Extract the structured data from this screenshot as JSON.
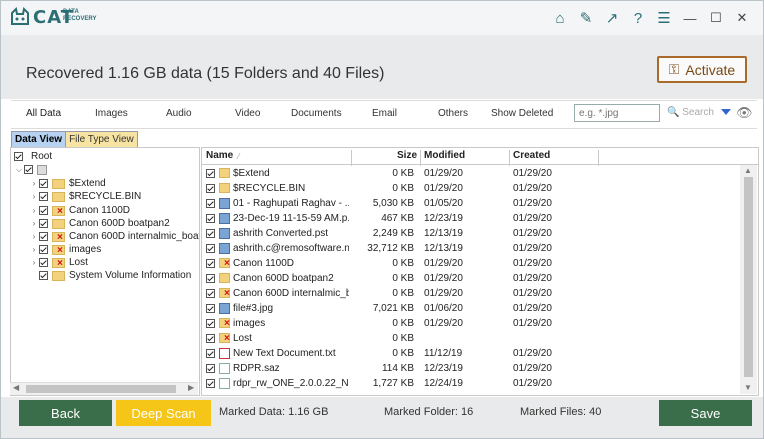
{
  "app": {
    "logo_name": "CAT",
    "logo_sub1": "DATA",
    "logo_sub2": "RECOVERY"
  },
  "titlebar_icons": [
    "home-icon",
    "wrench-icon",
    "export-icon",
    "help-icon",
    "menu-icon",
    "minimize-icon",
    "maximize-icon",
    "close-icon"
  ],
  "header": {
    "headline": "Recovered 1.16 GB data (15 Folders and 40 Files)",
    "activate_label": "Activate"
  },
  "tabs": [
    "All Data",
    "Images",
    "Audio",
    "Video",
    "Documents",
    "Email",
    "Others",
    "Show Deleted"
  ],
  "search": {
    "placeholder": "e.g. *.jpg",
    "button_label": "Search"
  },
  "view_tabs": {
    "data_view": "Data View",
    "file_type_view": "File Type View"
  },
  "tree": {
    "root": "Root",
    "items": [
      "$Extend",
      "$RECYCLE.BIN",
      "Canon 1100D",
      "Canon 600D boatpan2",
      "Canon 600D internalmic_boat-",
      "images",
      "Lost",
      "System Volume Information"
    ]
  },
  "file_table": {
    "headers": {
      "name": "Name",
      "size": "Size",
      "modified": "Modified",
      "created": "Created"
    },
    "rows": [
      {
        "name": "$Extend",
        "size": "0 KB",
        "modified": "01/29/20",
        "created": "01/29/20",
        "icon": "folder"
      },
      {
        "name": "$RECYCLE.BIN",
        "size": "0 KB",
        "modified": "01/29/20",
        "created": "01/29/20",
        "icon": "folder"
      },
      {
        "name": "01 - Raghupati Raghav - ...",
        "size": "5,030 KB",
        "modified": "01/05/20",
        "created": "01/29/20",
        "icon": "audio-file"
      },
      {
        "name": "23-Dec-19 11-15-59 AM.p...",
        "size": "467 KB",
        "modified": "12/23/19",
        "created": "01/29/20",
        "icon": "image-file"
      },
      {
        "name": "ashrith Converted.pst",
        "size": "2,249 KB",
        "modified": "12/13/19",
        "created": "01/29/20",
        "icon": "outlook-file"
      },
      {
        "name": "ashrith.c@remosoftware.n...",
        "size": "32,712 KB",
        "modified": "12/13/19",
        "created": "01/29/20",
        "icon": "outlook-file"
      },
      {
        "name": "Canon 1100D",
        "size": "0 KB",
        "modified": "01/29/20",
        "created": "01/29/20",
        "icon": "folder-deleted"
      },
      {
        "name": "Canon 600D boatpan2",
        "size": "0 KB",
        "modified": "01/29/20",
        "created": "01/29/20",
        "icon": "folder"
      },
      {
        "name": "Canon 600D internalmic_b...",
        "size": "0 KB",
        "modified": "01/29/20",
        "created": "01/29/20",
        "icon": "folder-deleted"
      },
      {
        "name": "file#3.jpg",
        "size": "7,021 KB",
        "modified": "01/06/20",
        "created": "01/29/20",
        "icon": "image-file"
      },
      {
        "name": "images",
        "size": "0 KB",
        "modified": "01/29/20",
        "created": "01/29/20",
        "icon": "folder-deleted"
      },
      {
        "name": "Lost",
        "size": "0 KB",
        "modified": "",
        "created": "",
        "icon": "folder-deleted"
      },
      {
        "name": "New Text Document.txt",
        "size": "0 KB",
        "modified": "11/12/19",
        "created": "01/29/20",
        "icon": "text-file-deleted"
      },
      {
        "name": "RDPR.saz",
        "size": "114 KB",
        "modified": "12/23/19",
        "created": "01/29/20",
        "icon": "file"
      },
      {
        "name": "rdpr_rw_ONE_2.0.0.22_Nol...",
        "size": "1,727 KB",
        "modified": "12/24/19",
        "created": "01/29/20",
        "icon": "file"
      }
    ]
  },
  "footer": {
    "back_label": "Back",
    "deep_scan_label": "Deep Scan",
    "marked_data": "Marked Data:  1.16 GB",
    "marked_folder": "Marked Folder:  16",
    "marked_files": "Marked Files:  40",
    "save_label": "Save"
  },
  "colors": {
    "accent_green": "#3a6e4a",
    "accent_yellow": "#f5c518",
    "activate_border": "#a96a2a",
    "brand_teal": "#2b6f75"
  }
}
